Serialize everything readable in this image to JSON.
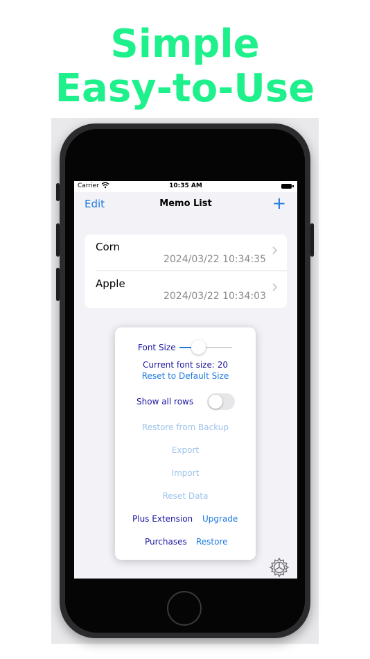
{
  "headline": {
    "line1": "Simple",
    "line2": "Easy-to-Use"
  },
  "status_bar": {
    "carrier": "Carrier",
    "time": "10:35 AM"
  },
  "nav": {
    "edit": "Edit",
    "title": "Memo List",
    "add": "+"
  },
  "memos": [
    {
      "title": "Corn",
      "date": "2024/03/22 10:34:35"
    },
    {
      "title": "Apple",
      "date": "2024/03/22 10:34:03"
    }
  ],
  "settings": {
    "font_size_label": "Font Size",
    "font_size_level": 0.22,
    "current_font_size": "Current font size: 20",
    "reset_default": "Reset to Default Size",
    "show_all_rows": "Show all rows",
    "show_all_rows_on": false,
    "restore_backup": "Restore from Backup",
    "export": "Export",
    "import": "Import",
    "reset_data": "Reset Data",
    "plus_extension": "Plus Extension",
    "upgrade": "Upgrade",
    "purchases": "Purchases",
    "restore": "Restore"
  },
  "colors": {
    "headline": "#1ef08c",
    "accent": "#1f7ae0",
    "label": "#1d17a0",
    "disabled": "#9ec3ec"
  },
  "icons": {
    "settings": "gear-icon",
    "wifi": "wifi-icon",
    "battery": "battery-icon",
    "chevron": "chevron-right-icon"
  }
}
